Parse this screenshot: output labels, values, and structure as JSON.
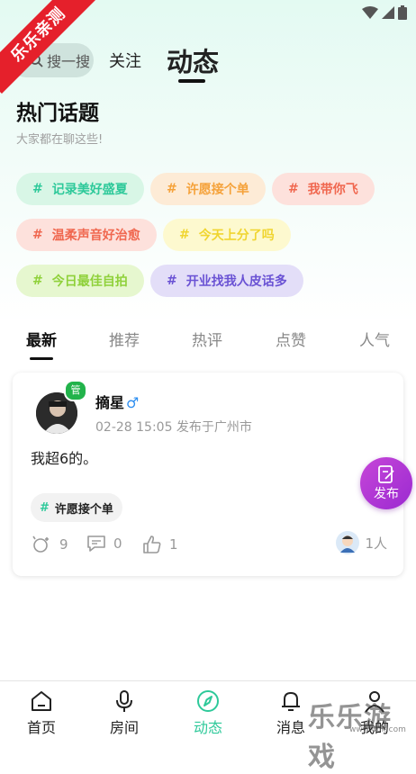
{
  "corner_banner": "乐乐亲测",
  "header": {
    "search_placeholder": "搜一搜",
    "tabs": [
      {
        "label": "关注"
      },
      {
        "label": "动态"
      }
    ]
  },
  "hot_topics": {
    "title": "热门话题",
    "subtitle": "大家都在聊这些!",
    "items": [
      {
        "label": "记录美好盛夏",
        "bg": "#d8f6e6",
        "color": "#2ec99a"
      },
      {
        "label": "许愿接个单",
        "bg": "#fdebd6",
        "color": "#f5a23a"
      },
      {
        "label": "我带你飞",
        "bg": "#fde1dc",
        "color": "#f0674f"
      },
      {
        "label": "温柔声音好治愈",
        "bg": "#fde1dc",
        "color": "#f0674f"
      },
      {
        "label": "今天上分了吗",
        "bg": "#fdf9cf",
        "color": "#f5e13a"
      },
      {
        "label": "今日最佳自拍",
        "bg": "#e6f7cf",
        "color": "#8fd13a"
      },
      {
        "label": "开业找我人皮话多",
        "bg": "#e3def8",
        "color": "#6a52d4"
      }
    ]
  },
  "feed_tabs": [
    "最新",
    "推荐",
    "热评",
    "点赞",
    "人气"
  ],
  "post": {
    "admin_badge": "管",
    "username": "摘星",
    "gender_symbol": "♂",
    "meta": "02-28 15:05 发布于广州市",
    "text": "我超6的。",
    "tag": "许愿接个单",
    "likes": "9",
    "comments": "0",
    "thumbs": "1",
    "viewers": "1人"
  },
  "fab_label": "发布",
  "bottom_nav": [
    {
      "label": "首页",
      "icon": "home-icon"
    },
    {
      "label": "房间",
      "icon": "microphone-icon"
    },
    {
      "label": "动态",
      "icon": "compass-icon"
    },
    {
      "label": "消息",
      "icon": "bell-icon"
    },
    {
      "label": "我的",
      "icon": "user-icon"
    }
  ],
  "watermark": "乐乐游戏",
  "watermark_url": "www.46k.com",
  "colors": {
    "accent": "#2ec99a",
    "fab": "#b03ad6",
    "admin_badge": "#22b34b"
  }
}
